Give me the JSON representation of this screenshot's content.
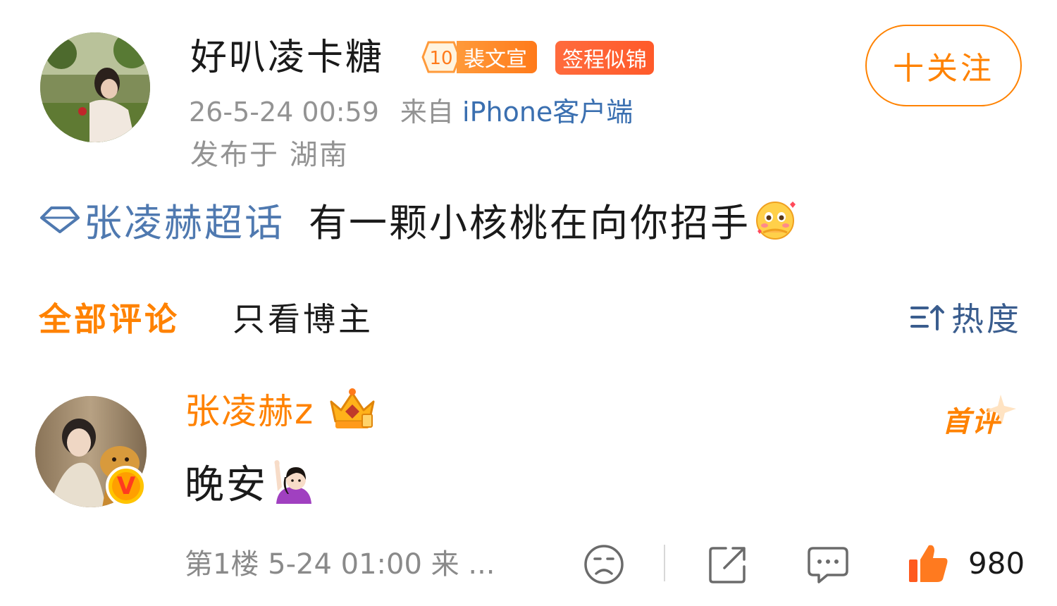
{
  "post": {
    "author": "好叭凌卡糖",
    "level": "10",
    "fan_badge": "裴文宣",
    "sign_badge": "签程似锦",
    "follow_label": "十关注",
    "time": "26-5-24 00:59",
    "source_prefix": "来自",
    "source": "iPhone客户端",
    "location": "发布于 湖南",
    "topic": "张凌赫超话",
    "text": "有一颗小核桃在向你招手",
    "icons": {
      "avatar": "avatar-photo",
      "topic": "diamond-icon",
      "emoji": "blushing-face-emoji"
    }
  },
  "tabs": {
    "all": "全部评论",
    "author_only": "只看博主",
    "sort": "热度",
    "sort_icon": "sort-icon"
  },
  "comment": {
    "user": "张凌赫z",
    "badge_icon": "crown-icon",
    "verified": "V",
    "first_label": "首评",
    "text": "晚安",
    "emoji": "raising-hand-emoji",
    "floor_meta": "第1楼  5-24 01:00  来 ...",
    "likes": "980",
    "actions": [
      "sad-face-icon",
      "share-icon",
      "comment-icon",
      "like-icon"
    ]
  },
  "colors": {
    "accent": "#ff8200",
    "link": "#3a6fb0",
    "topic": "#4f79b0",
    "muted": "#939393"
  }
}
